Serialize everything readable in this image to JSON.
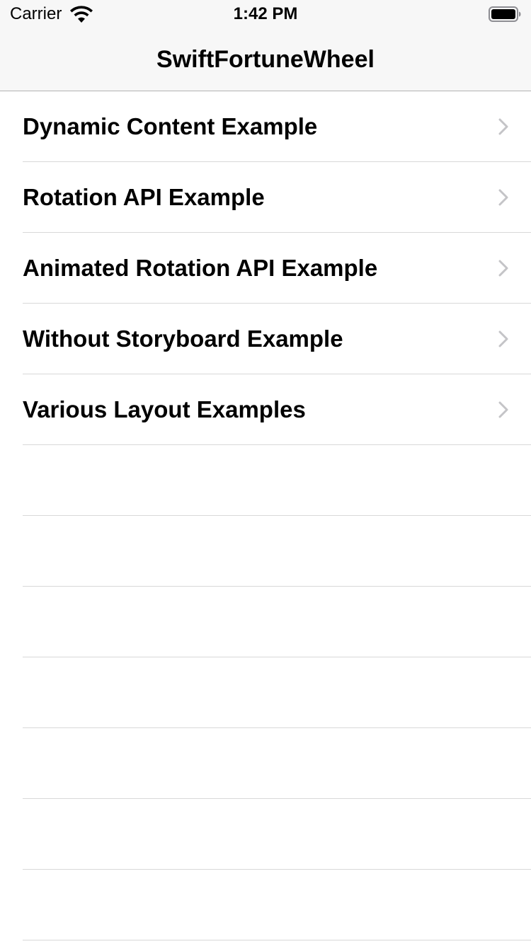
{
  "status_bar": {
    "carrier": "Carrier",
    "time": "1:42 PM",
    "wifi_icon": "wifi-icon",
    "battery_icon": "battery-icon"
  },
  "nav": {
    "title": "SwiftFortuneWheel"
  },
  "list": {
    "items": [
      {
        "label": "Dynamic Content Example",
        "accessory": "chevron-right-icon"
      },
      {
        "label": "Rotation API Example",
        "accessory": "chevron-right-icon"
      },
      {
        "label": "Animated Rotation API Example",
        "accessory": "chevron-right-icon"
      },
      {
        "label": "Without Storyboard Example",
        "accessory": "chevron-right-icon"
      },
      {
        "label": "Various Layout Examples",
        "accessory": "chevron-right-icon"
      }
    ]
  },
  "colors": {
    "bar_background": "#f7f7f7",
    "separator": "#d8d8d8",
    "chevron": "#c4c4c7"
  }
}
